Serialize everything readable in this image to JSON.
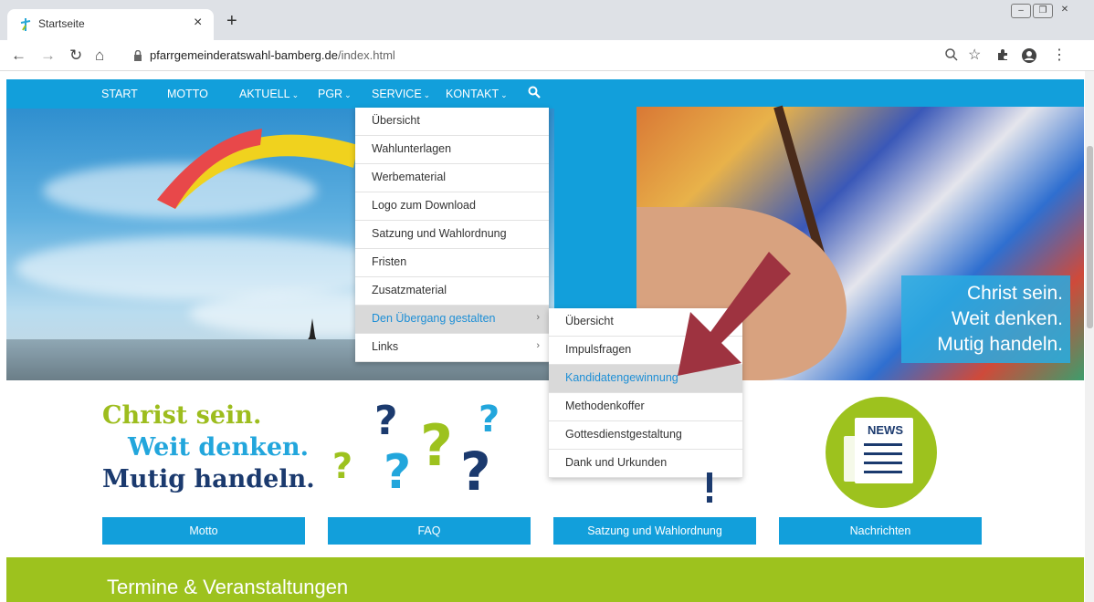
{
  "browser": {
    "tab_title": "Startseite",
    "tab_close": "×",
    "new_tab": "+",
    "url_domain": "pfarrgemeinderatswahl-bamberg.de",
    "url_path": "/index.html"
  },
  "nav": {
    "items": [
      {
        "label": "START"
      },
      {
        "label": "MOTTO"
      },
      {
        "label": "AKTUELL"
      },
      {
        "label": "PGR"
      },
      {
        "label": "SERVICE"
      },
      {
        "label": "KONTAKT"
      }
    ],
    "chevron": "⌄"
  },
  "service_menu": {
    "items": [
      {
        "label": "Übersicht"
      },
      {
        "label": "Wahlunterlagen"
      },
      {
        "label": "Werbematerial"
      },
      {
        "label": "Logo zum Download"
      },
      {
        "label": "Satzung und Wahlordnung"
      },
      {
        "label": "Fristen"
      },
      {
        "label": "Zusatzmaterial"
      },
      {
        "label": "Den Übergang gestalten"
      },
      {
        "label": "Links"
      }
    ],
    "submenu_arrow": "›"
  },
  "submenu": {
    "items": [
      {
        "label": "Übersicht"
      },
      {
        "label": "Impulsfragen"
      },
      {
        "label": "Kandidatengewinnung"
      },
      {
        "label": "Methodenkoffer"
      },
      {
        "label": "Gottesdienstgestaltung"
      },
      {
        "label": "Dank und Urkunden"
      }
    ]
  },
  "hero": {
    "slogan_lines": [
      "Christ sein.",
      "Weit denken.",
      "Mutig handeln."
    ]
  },
  "slogan": {
    "line1": "Christ sein.",
    "line2": "Weit denken.",
    "line3": "Mutig handeln."
  },
  "news_icon_label": "NEWS",
  "cta_buttons": [
    {
      "label": "Motto"
    },
    {
      "label": "FAQ"
    },
    {
      "label": "Satzung und Wahlordnung"
    },
    {
      "label": "Nachrichten"
    }
  ],
  "footer": {
    "title": "Termine & Veranstaltungen"
  },
  "colors": {
    "blue": "#129fdb",
    "green": "#9dc21e",
    "navy": "#1b3a6e",
    "arrow": "#9e3340"
  }
}
